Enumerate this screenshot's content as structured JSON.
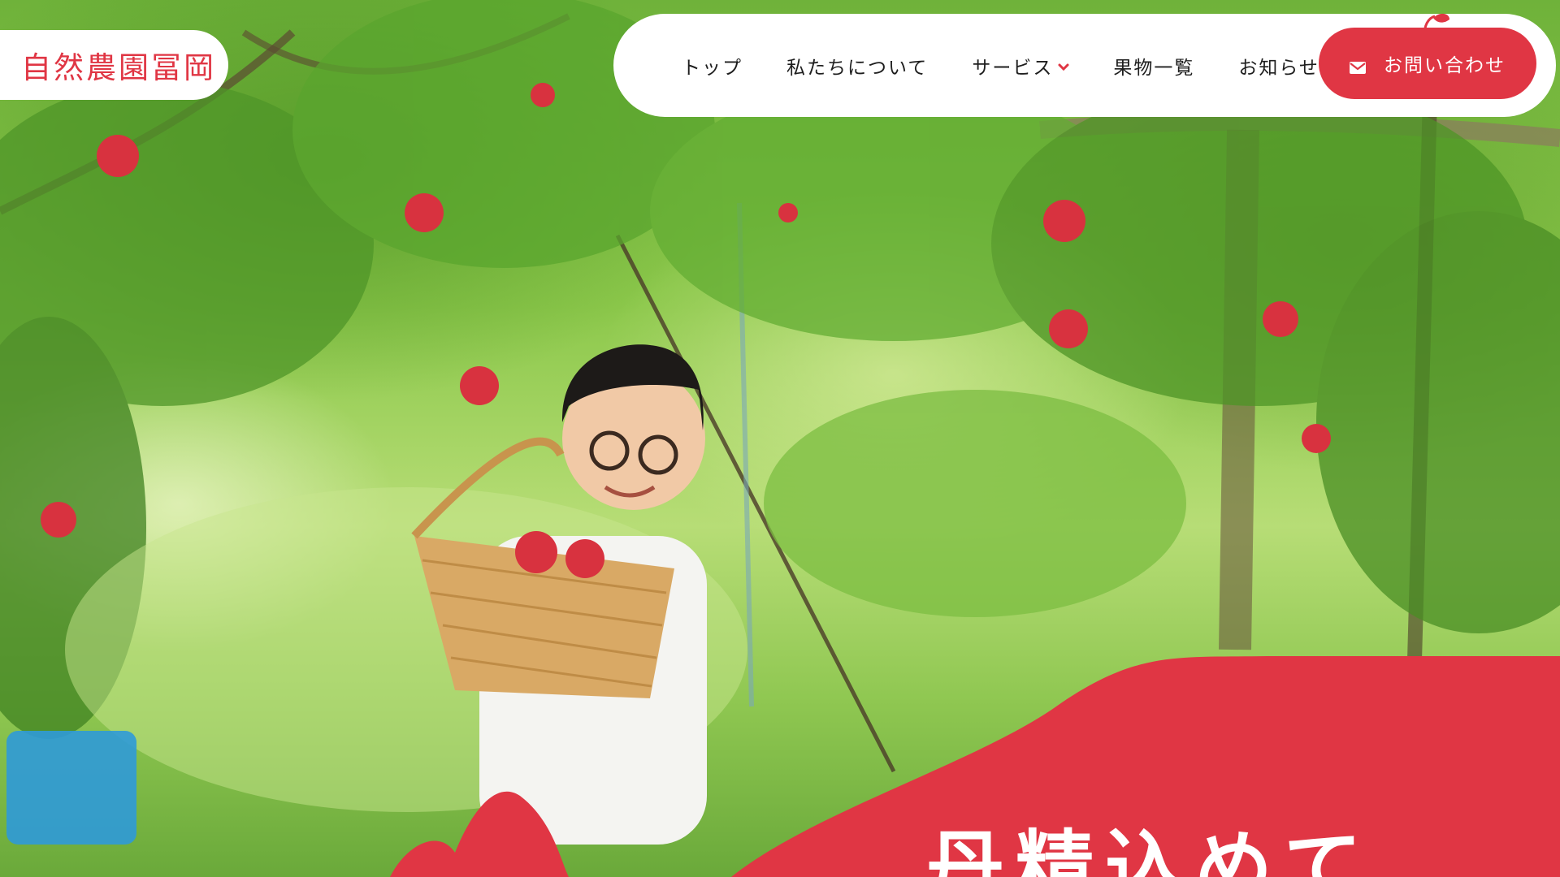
{
  "brand": {
    "logo_text": "自然農園冨岡",
    "accent_color": "#e03644"
  },
  "nav": {
    "items": [
      {
        "label": "トップ",
        "has_dropdown": false
      },
      {
        "label": "私たちについて",
        "has_dropdown": false
      },
      {
        "label": "サービス",
        "has_dropdown": true
      },
      {
        "label": "果物一覧",
        "has_dropdown": false
      },
      {
        "label": "お知らせ",
        "has_dropdown": false
      }
    ],
    "dropdown_icon": "chevron-down-icon",
    "contact": {
      "label": "お問い合わせ",
      "icon": "mail-icon"
    }
  },
  "hero": {
    "image_alt": "child holding basket of apples in orchard",
    "headline": "丹精込めて"
  }
}
